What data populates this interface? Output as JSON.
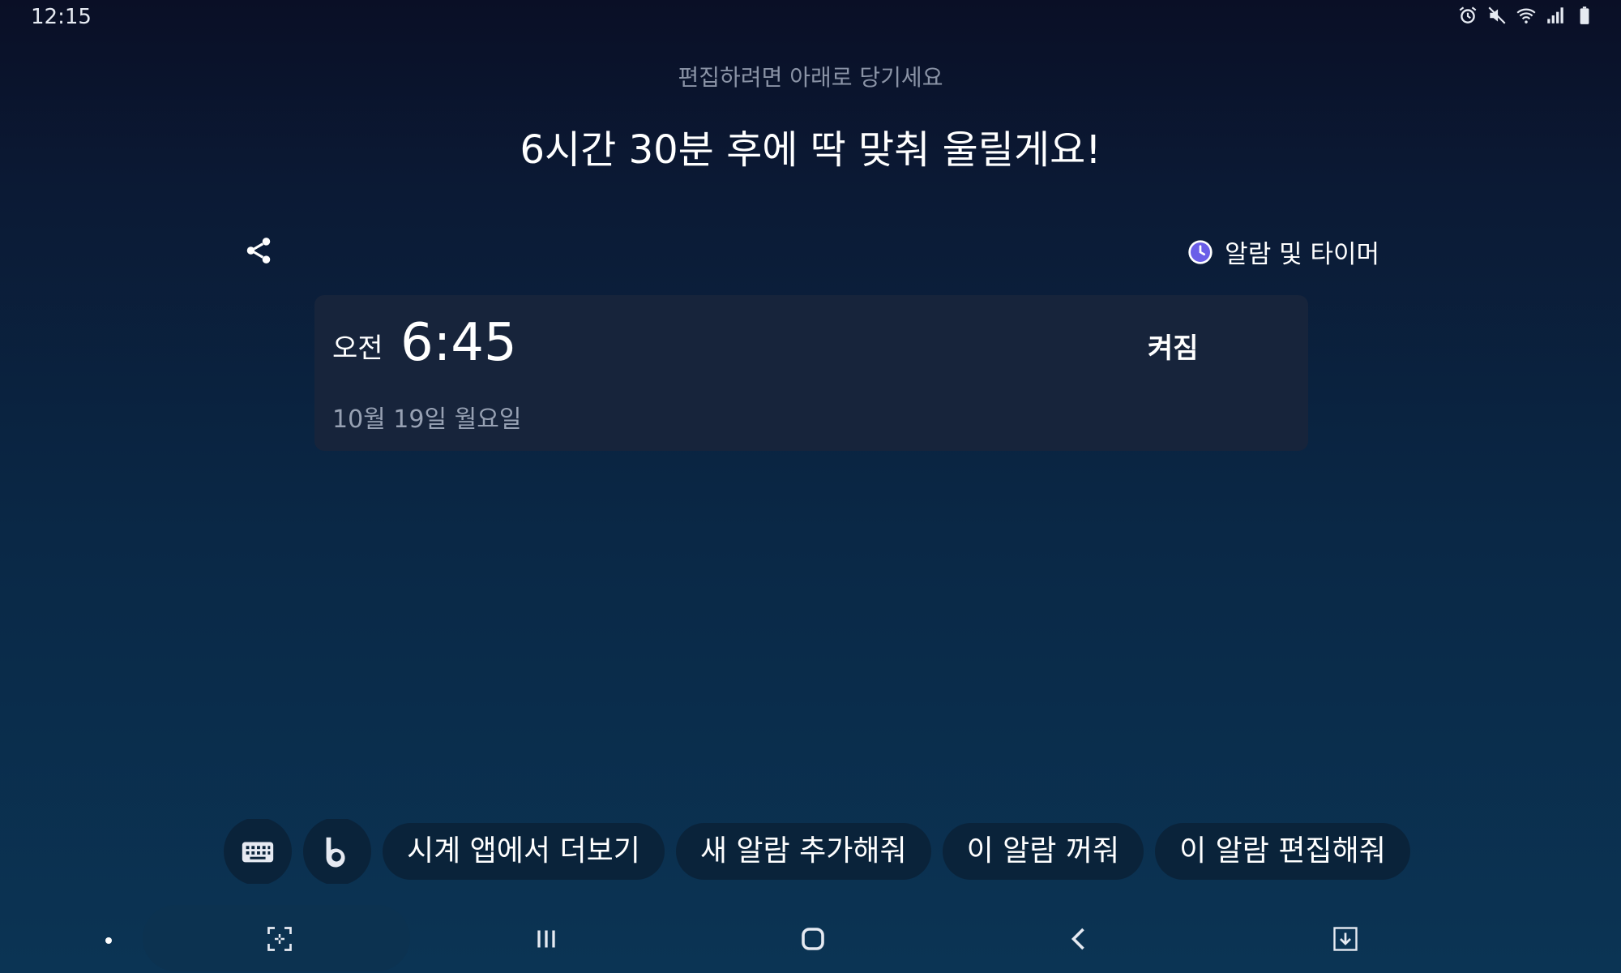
{
  "status_bar": {
    "time": "12:15",
    "icons": [
      "alarm-icon",
      "mute-icon",
      "wifi-icon",
      "signal-icon",
      "battery-icon"
    ]
  },
  "hint": "편집하려면 아래로 당기세요",
  "headline": "6시간 30분 후에 딱 맞춰 울릴게요!",
  "share_icon": "share-icon",
  "app_link": {
    "icon": "clock-icon",
    "label": "알람 및 타이머",
    "accent": "#6a5ee8"
  },
  "alarm": {
    "ampm": "오전",
    "time": "6:45",
    "status": "켜짐",
    "date": "10월 19일 월요일"
  },
  "quick_actions": {
    "keyboard_icon": "keyboard-icon",
    "bixby_icon": "bixby-icon",
    "chips": [
      "시계 앱에서 더보기",
      "새 알람 추가해줘",
      "이 알람 꺼줘",
      "이 알람 편집해줘"
    ]
  },
  "nav_bar": {
    "icons": [
      "capture-icon",
      "recent-apps-icon",
      "home-icon",
      "back-icon",
      "download-icon"
    ]
  },
  "colors": {
    "card": "#17243b",
    "chip": "#0a233a",
    "hint": "#8a93a6"
  }
}
